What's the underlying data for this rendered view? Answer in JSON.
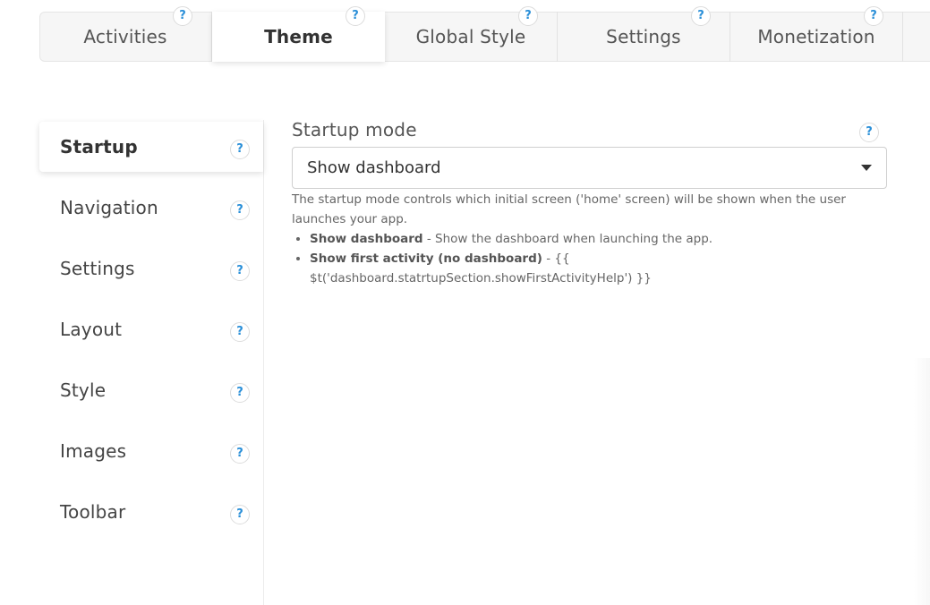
{
  "tabs": [
    {
      "label": "Activities",
      "active": false
    },
    {
      "label": "Theme",
      "active": true
    },
    {
      "label": "Global Style",
      "active": false
    },
    {
      "label": "Settings",
      "active": false
    },
    {
      "label": "Monetization",
      "active": false
    }
  ],
  "help_glyph": "?",
  "sidebar": {
    "items": [
      {
        "label": "Startup",
        "active": true
      },
      {
        "label": "Navigation",
        "active": false
      },
      {
        "label": "Settings",
        "active": false
      },
      {
        "label": "Layout",
        "active": false
      },
      {
        "label": "Style",
        "active": false
      },
      {
        "label": "Images",
        "active": false
      },
      {
        "label": "Toolbar",
        "active": false
      }
    ]
  },
  "startup": {
    "label": "Startup mode",
    "selected": "Show dashboard",
    "description": "The startup mode controls which initial screen ('home' screen) will be shown when the user launches your app.",
    "options": [
      {
        "name": "Show dashboard",
        "text": " - Show the dashboard when launching the app."
      },
      {
        "name": "Show first activity (no dashboard)",
        "text": " - {{ $t('dashboard.statrtupSection.showFirstActivityHelp') }}"
      }
    ]
  },
  "colors": {
    "help_icon": "#2a8fd8",
    "border": "#cfcfcf"
  }
}
